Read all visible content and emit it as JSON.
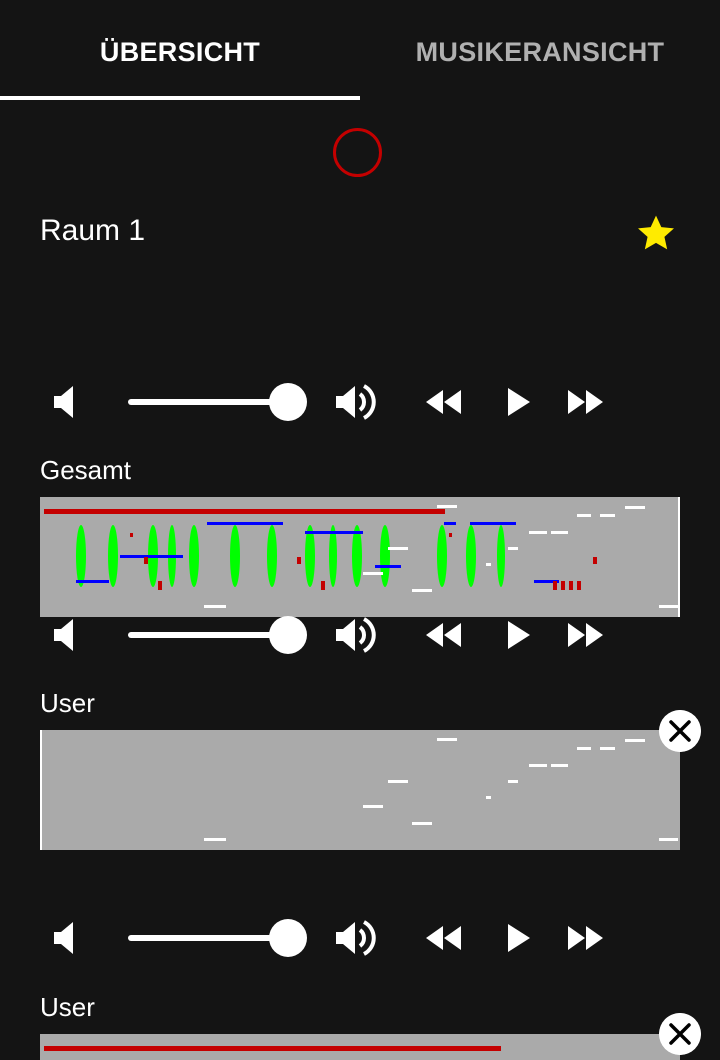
{
  "tabs": [
    {
      "label": "ÜBERSICHT",
      "active": true
    },
    {
      "label": "MUSIKERANSICHT",
      "active": false
    }
  ],
  "room": {
    "title": "Raum 1",
    "favorite": true,
    "star_color": "#ffeb00",
    "record_color": "#c40000"
  },
  "controls": {
    "icons": [
      "volume-mute-icon",
      "volume-up-icon",
      "rewind-icon",
      "play-icon",
      "fast-forward-icon"
    ],
    "volume": 1.0
  },
  "tracks": [
    {
      "label": "Gesamt",
      "removable": false
    },
    {
      "label": "User",
      "removable": true
    },
    {
      "label": "User",
      "removable": true
    }
  ],
  "colors": {
    "background": "#141414",
    "track_bg": "#aaaaaa",
    "playhead": "#c40000",
    "note_green": "#00ff00",
    "note_blue": "#0000ff",
    "note_white": "#ffffff",
    "note_red": "#c40000"
  }
}
